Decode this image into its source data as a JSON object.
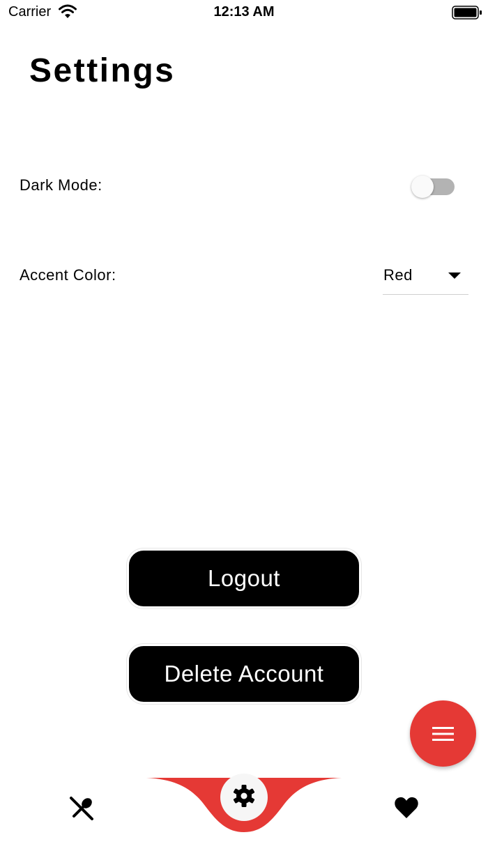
{
  "status_bar": {
    "carrier": "Carrier",
    "time": "12:13 AM"
  },
  "page": {
    "title": "Settings"
  },
  "settings": {
    "dark_mode": {
      "label": "Dark Mode:",
      "enabled": false
    },
    "accent_color": {
      "label": "Accent Color:",
      "selected": "Red"
    }
  },
  "actions": {
    "logout_label": "Logout",
    "delete_account_label": "Delete Account"
  },
  "fab": {
    "icon": "menu-icon",
    "color": "#e53935"
  },
  "bottom_nav": {
    "items": [
      {
        "icon": "utensils-icon",
        "active": false
      },
      {
        "icon": "gear-icon",
        "active": true
      },
      {
        "icon": "heart-icon",
        "active": false
      }
    ],
    "accent_color": "#e53935"
  }
}
